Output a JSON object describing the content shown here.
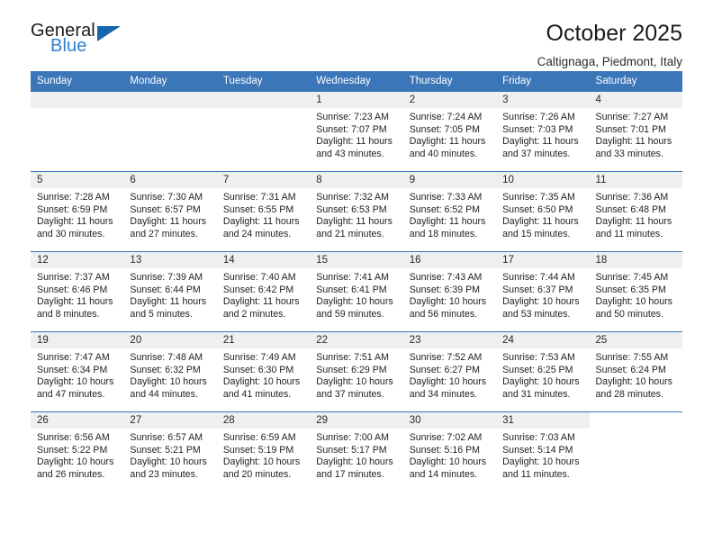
{
  "brand": {
    "word_one": "General",
    "word_two": "Blue",
    "triangle_color": "#1667b0",
    "blue_text_color": "#2f7fd0"
  },
  "header": {
    "title": "October 2025",
    "subtitle": "Caltignaga, Piedmont, Italy",
    "accent_color": "#3b76b9",
    "daynum_background": "#efefef"
  },
  "weekday_headers": [
    "Sunday",
    "Monday",
    "Tuesday",
    "Wednesday",
    "Thursday",
    "Friday",
    "Saturday"
  ],
  "labels": {
    "sunrise_prefix": "Sunrise:",
    "sunset_prefix": "Sunset:",
    "daylight_prefix": "Daylight:"
  },
  "weeks": [
    [
      {
        "day": "",
        "empty": true,
        "blank": false
      },
      {
        "day": "",
        "empty": true,
        "blank": false
      },
      {
        "day": "",
        "empty": true,
        "blank": false
      },
      {
        "day": "1",
        "sunrise": "Sunrise: 7:23 AM",
        "sunset": "Sunset: 7:07 PM",
        "daylight_line1": "Daylight: 11 hours",
        "daylight_line2": "and 43 minutes."
      },
      {
        "day": "2",
        "sunrise": "Sunrise: 7:24 AM",
        "sunset": "Sunset: 7:05 PM",
        "daylight_line1": "Daylight: 11 hours",
        "daylight_line2": "and 40 minutes."
      },
      {
        "day": "3",
        "sunrise": "Sunrise: 7:26 AM",
        "sunset": "Sunset: 7:03 PM",
        "daylight_line1": "Daylight: 11 hours",
        "daylight_line2": "and 37 minutes."
      },
      {
        "day": "4",
        "sunrise": "Sunrise: 7:27 AM",
        "sunset": "Sunset: 7:01 PM",
        "daylight_line1": "Daylight: 11 hours",
        "daylight_line2": "and 33 minutes."
      }
    ],
    [
      {
        "day": "5",
        "sunrise": "Sunrise: 7:28 AM",
        "sunset": "Sunset: 6:59 PM",
        "daylight_line1": "Daylight: 11 hours",
        "daylight_line2": "and 30 minutes."
      },
      {
        "day": "6",
        "sunrise": "Sunrise: 7:30 AM",
        "sunset": "Sunset: 6:57 PM",
        "daylight_line1": "Daylight: 11 hours",
        "daylight_line2": "and 27 minutes."
      },
      {
        "day": "7",
        "sunrise": "Sunrise: 7:31 AM",
        "sunset": "Sunset: 6:55 PM",
        "daylight_line1": "Daylight: 11 hours",
        "daylight_line2": "and 24 minutes."
      },
      {
        "day": "8",
        "sunrise": "Sunrise: 7:32 AM",
        "sunset": "Sunset: 6:53 PM",
        "daylight_line1": "Daylight: 11 hours",
        "daylight_line2": "and 21 minutes."
      },
      {
        "day": "9",
        "sunrise": "Sunrise: 7:33 AM",
        "sunset": "Sunset: 6:52 PM",
        "daylight_line1": "Daylight: 11 hours",
        "daylight_line2": "and 18 minutes."
      },
      {
        "day": "10",
        "sunrise": "Sunrise: 7:35 AM",
        "sunset": "Sunset: 6:50 PM",
        "daylight_line1": "Daylight: 11 hours",
        "daylight_line2": "and 15 minutes."
      },
      {
        "day": "11",
        "sunrise": "Sunrise: 7:36 AM",
        "sunset": "Sunset: 6:48 PM",
        "daylight_line1": "Daylight: 11 hours",
        "daylight_line2": "and 11 minutes."
      }
    ],
    [
      {
        "day": "12",
        "sunrise": "Sunrise: 7:37 AM",
        "sunset": "Sunset: 6:46 PM",
        "daylight_line1": "Daylight: 11 hours",
        "daylight_line2": "and 8 minutes."
      },
      {
        "day": "13",
        "sunrise": "Sunrise: 7:39 AM",
        "sunset": "Sunset: 6:44 PM",
        "daylight_line1": "Daylight: 11 hours",
        "daylight_line2": "and 5 minutes."
      },
      {
        "day": "14",
        "sunrise": "Sunrise: 7:40 AM",
        "sunset": "Sunset: 6:42 PM",
        "daylight_line1": "Daylight: 11 hours",
        "daylight_line2": "and 2 minutes."
      },
      {
        "day": "15",
        "sunrise": "Sunrise: 7:41 AM",
        "sunset": "Sunset: 6:41 PM",
        "daylight_line1": "Daylight: 10 hours",
        "daylight_line2": "and 59 minutes."
      },
      {
        "day": "16",
        "sunrise": "Sunrise: 7:43 AM",
        "sunset": "Sunset: 6:39 PM",
        "daylight_line1": "Daylight: 10 hours",
        "daylight_line2": "and 56 minutes."
      },
      {
        "day": "17",
        "sunrise": "Sunrise: 7:44 AM",
        "sunset": "Sunset: 6:37 PM",
        "daylight_line1": "Daylight: 10 hours",
        "daylight_line2": "and 53 minutes."
      },
      {
        "day": "18",
        "sunrise": "Sunrise: 7:45 AM",
        "sunset": "Sunset: 6:35 PM",
        "daylight_line1": "Daylight: 10 hours",
        "daylight_line2": "and 50 minutes."
      }
    ],
    [
      {
        "day": "19",
        "sunrise": "Sunrise: 7:47 AM",
        "sunset": "Sunset: 6:34 PM",
        "daylight_line1": "Daylight: 10 hours",
        "daylight_line2": "and 47 minutes."
      },
      {
        "day": "20",
        "sunrise": "Sunrise: 7:48 AM",
        "sunset": "Sunset: 6:32 PM",
        "daylight_line1": "Daylight: 10 hours",
        "daylight_line2": "and 44 minutes."
      },
      {
        "day": "21",
        "sunrise": "Sunrise: 7:49 AM",
        "sunset": "Sunset: 6:30 PM",
        "daylight_line1": "Daylight: 10 hours",
        "daylight_line2": "and 41 minutes."
      },
      {
        "day": "22",
        "sunrise": "Sunrise: 7:51 AM",
        "sunset": "Sunset: 6:29 PM",
        "daylight_line1": "Daylight: 10 hours",
        "daylight_line2": "and 37 minutes."
      },
      {
        "day": "23",
        "sunrise": "Sunrise: 7:52 AM",
        "sunset": "Sunset: 6:27 PM",
        "daylight_line1": "Daylight: 10 hours",
        "daylight_line2": "and 34 minutes."
      },
      {
        "day": "24",
        "sunrise": "Sunrise: 7:53 AM",
        "sunset": "Sunset: 6:25 PM",
        "daylight_line1": "Daylight: 10 hours",
        "daylight_line2": "and 31 minutes."
      },
      {
        "day": "25",
        "sunrise": "Sunrise: 7:55 AM",
        "sunset": "Sunset: 6:24 PM",
        "daylight_line1": "Daylight: 10 hours",
        "daylight_line2": "and 28 minutes."
      }
    ],
    [
      {
        "day": "26",
        "sunrise": "Sunrise: 6:56 AM",
        "sunset": "Sunset: 5:22 PM",
        "daylight_line1": "Daylight: 10 hours",
        "daylight_line2": "and 26 minutes."
      },
      {
        "day": "27",
        "sunrise": "Sunrise: 6:57 AM",
        "sunset": "Sunset: 5:21 PM",
        "daylight_line1": "Daylight: 10 hours",
        "daylight_line2": "and 23 minutes."
      },
      {
        "day": "28",
        "sunrise": "Sunrise: 6:59 AM",
        "sunset": "Sunset: 5:19 PM",
        "daylight_line1": "Daylight: 10 hours",
        "daylight_line2": "and 20 minutes."
      },
      {
        "day": "29",
        "sunrise": "Sunrise: 7:00 AM",
        "sunset": "Sunset: 5:17 PM",
        "daylight_line1": "Daylight: 10 hours",
        "daylight_line2": "and 17 minutes."
      },
      {
        "day": "30",
        "sunrise": "Sunrise: 7:02 AM",
        "sunset": "Sunset: 5:16 PM",
        "daylight_line1": "Daylight: 10 hours",
        "daylight_line2": "and 14 minutes."
      },
      {
        "day": "31",
        "sunrise": "Sunrise: 7:03 AM",
        "sunset": "Sunset: 5:14 PM",
        "daylight_line1": "Daylight: 10 hours",
        "daylight_line2": "and 11 minutes."
      },
      {
        "day": "",
        "empty": true,
        "blank": true
      }
    ]
  ]
}
